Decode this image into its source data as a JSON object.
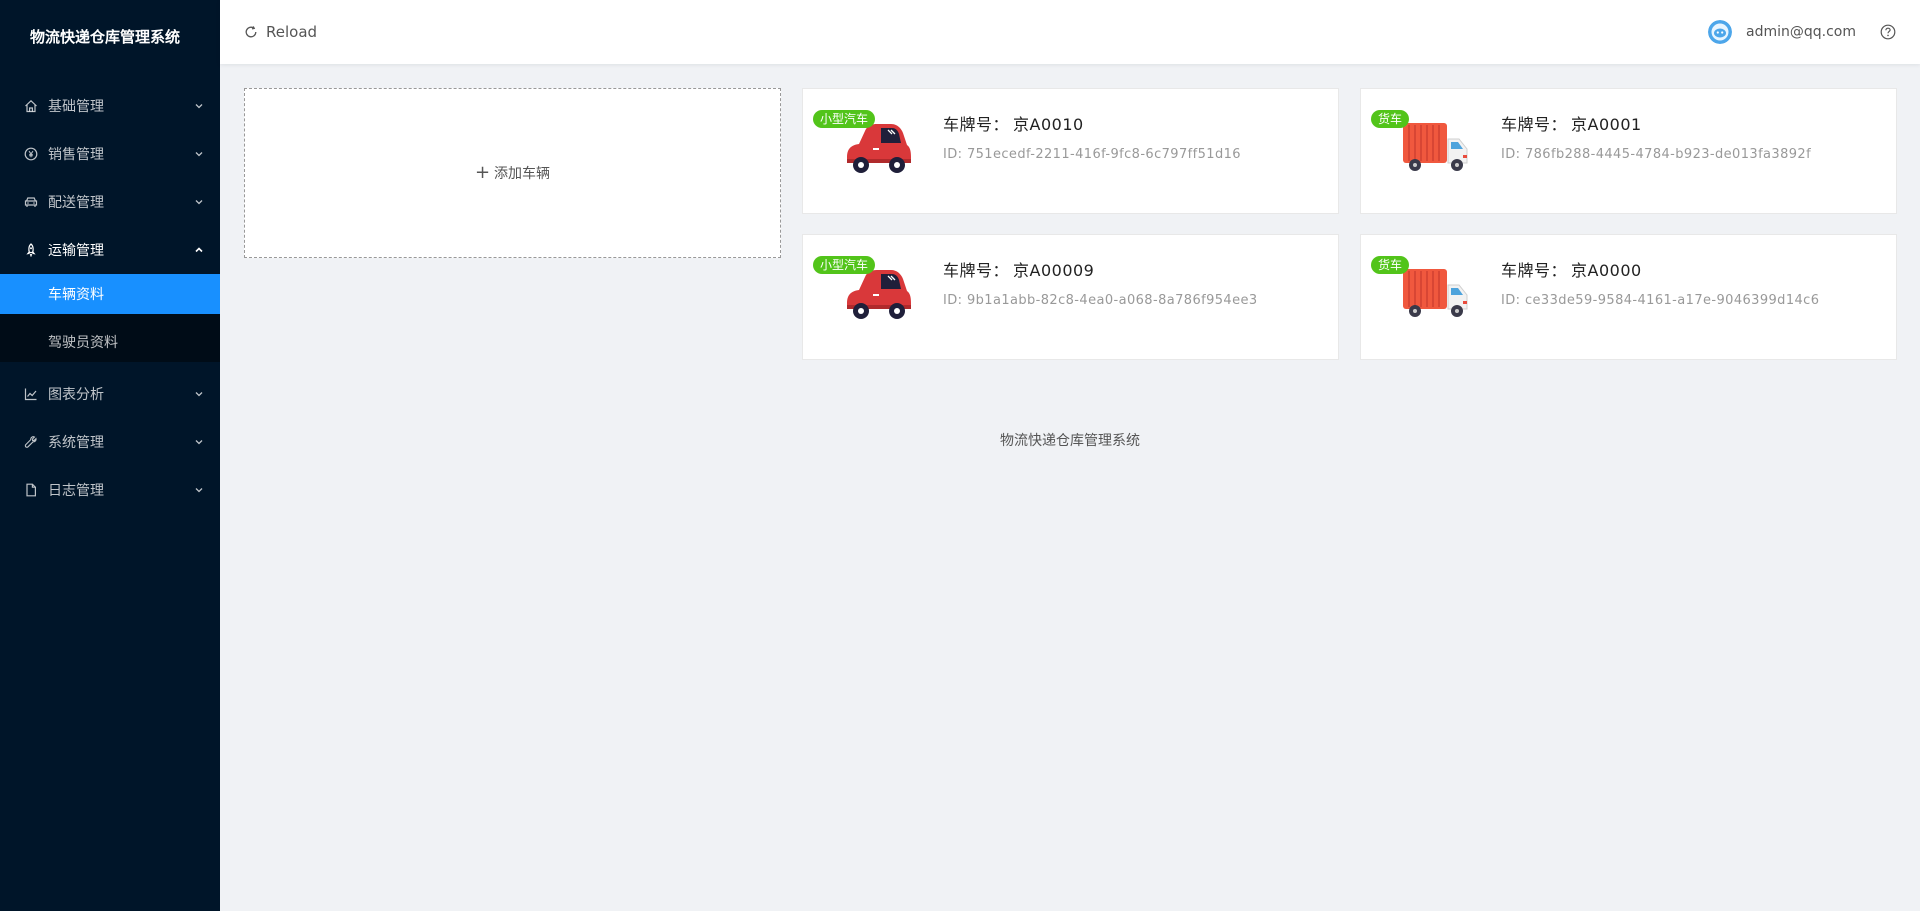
{
  "app": {
    "title": "物流快递仓库管理系统"
  },
  "sidebar": {
    "items": [
      {
        "label": "基础管理",
        "icon": "home-icon"
      },
      {
        "label": "销售管理",
        "icon": "yen-icon"
      },
      {
        "label": "配送管理",
        "icon": "car-icon"
      },
      {
        "label": "运输管理",
        "icon": "rocket-icon",
        "open": true,
        "children": [
          {
            "label": "车辆资料",
            "active": true
          },
          {
            "label": "驾驶员资料"
          }
        ]
      },
      {
        "label": "图表分析",
        "icon": "line-chart-icon"
      },
      {
        "label": "系统管理",
        "icon": "tool-icon"
      },
      {
        "label": "日志管理",
        "icon": "file-icon"
      }
    ]
  },
  "header": {
    "reload_label": "Reload",
    "user_email": "admin@qq.com"
  },
  "main": {
    "add_vehicle_label": "添加车辆",
    "plate_prefix": "车牌号：",
    "vehicles": [
      {
        "type_tag": "小型汽车",
        "plate": "京A0010",
        "id": "ID: 751ecedf-2211-416f-9fc8-6c797ff51d16",
        "kind": "car"
      },
      {
        "type_tag": "货车",
        "plate": "京A0001",
        "id": "ID: 786fb288-4445-4784-b923-de013fa3892f",
        "kind": "truck"
      },
      {
        "type_tag": "小型汽车",
        "plate": "京A00009",
        "id": "ID: 9b1a1abb-82c8-4ea0-a068-8a786f954ee3",
        "kind": "car"
      },
      {
        "type_tag": "货车",
        "plate": "京A0000",
        "id": "ID: ce33de59-9584-4161-a17e-9046399d14c6",
        "kind": "truck"
      }
    ]
  },
  "footer": {
    "text": "物流快递仓库管理系统"
  },
  "colors": {
    "sidebar_bg": "#001529",
    "active": "#1890ff",
    "tag": "#52c41a"
  }
}
